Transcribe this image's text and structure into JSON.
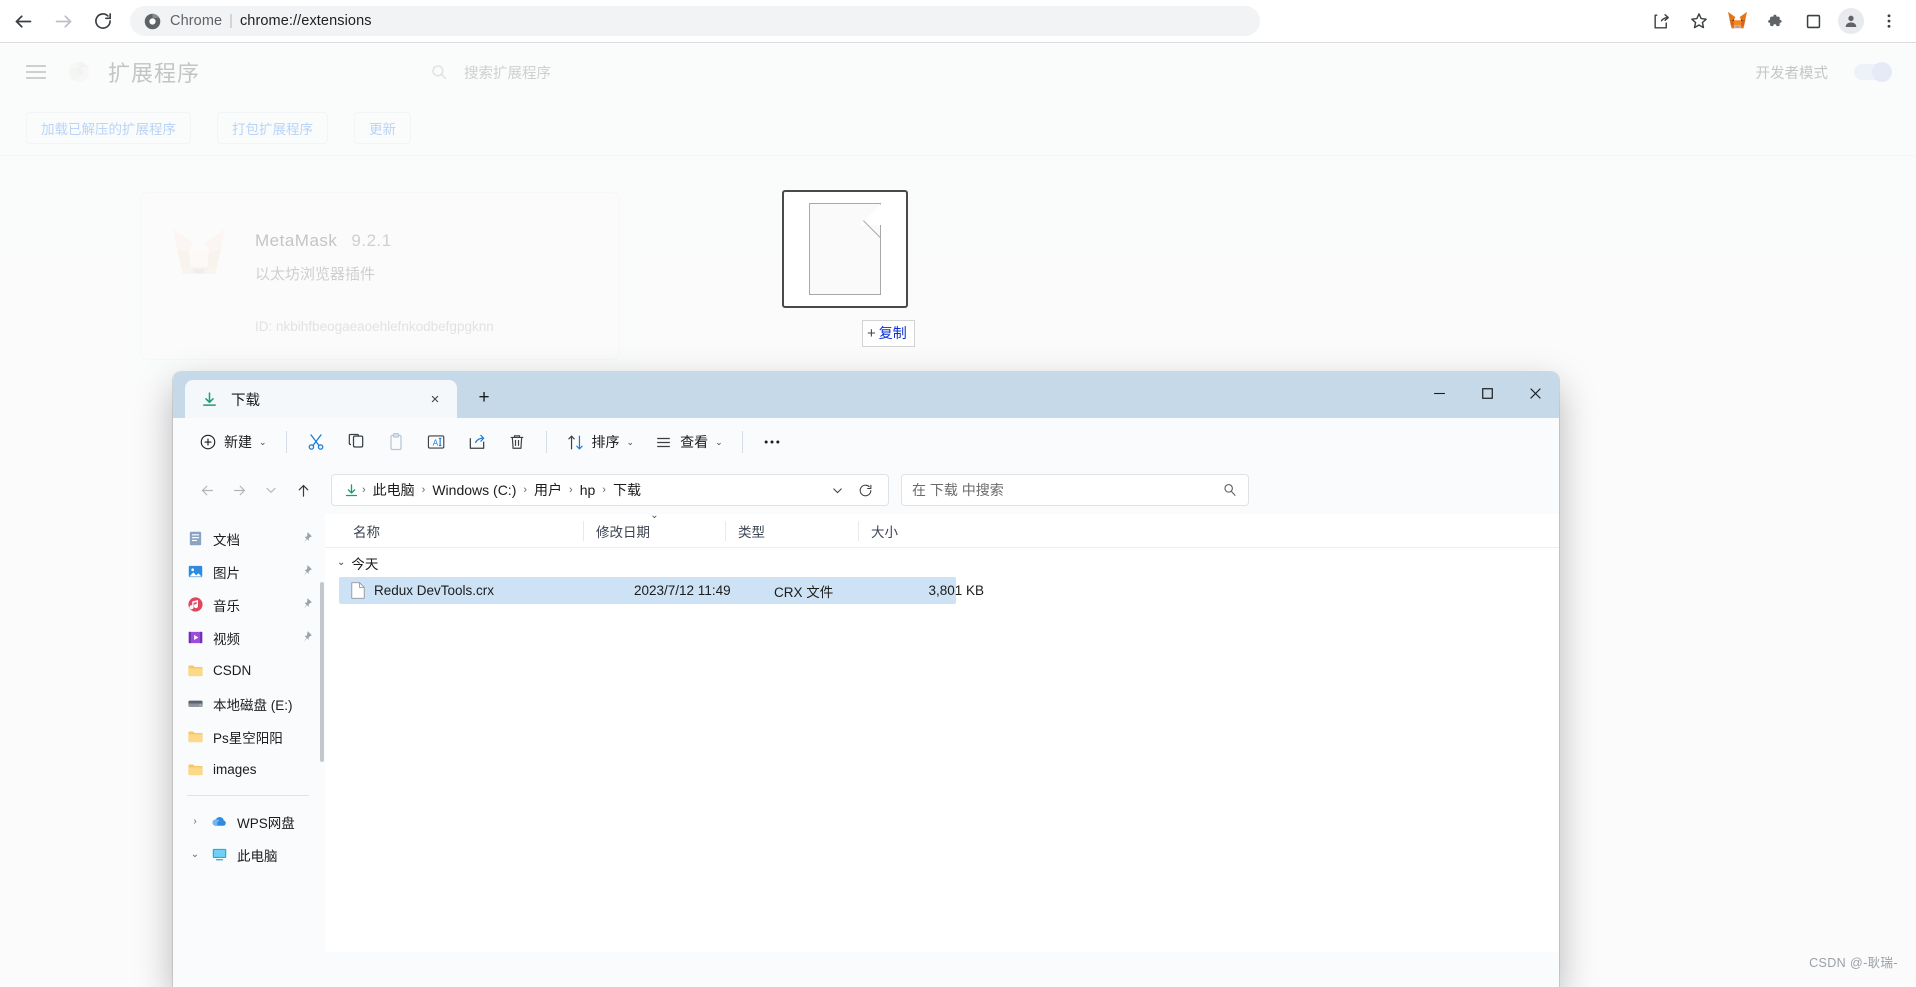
{
  "browser": {
    "nav": {
      "back": "back-arrow",
      "forward": "forward-arrow",
      "reload": "reload"
    },
    "omnibox": {
      "scheme_label": "Chrome",
      "divider": "|",
      "url": "chrome://extensions"
    },
    "right_icons": [
      "share-icon",
      "star-icon",
      "metamask-icon",
      "extensions-puzzle-icon",
      "side-panel-icon",
      "profile-avatar-icon",
      "chrome-menu-icon"
    ]
  },
  "extensions_page": {
    "title": "扩展程序",
    "search_placeholder": "搜索扩展程序",
    "devmode_label": "开发者模式",
    "devmode_on": true,
    "actions": [
      "加载已解压的扩展程序",
      "打包扩展程序",
      "更新"
    ],
    "card": {
      "name": "MetaMask",
      "version": "9.2.1",
      "description": "以太坊浏览器插件",
      "id_label": "ID:",
      "id_value": "nkbihfbeogaeaoehlefnkodbefgpgknn"
    }
  },
  "drag": {
    "badge_plus": "+",
    "badge_label": "复制"
  },
  "explorer": {
    "tab": {
      "title": "下载",
      "close": "×",
      "new_tab": "+"
    },
    "window_controls": {
      "minimize": "—",
      "maximize": "□",
      "close": "✕"
    },
    "toolbar": {
      "new_label": "新建",
      "cut_label": "剪切",
      "copy_label": "复制",
      "paste_label": "粘贴",
      "rename_label": "重命名",
      "share_label": "共享",
      "delete_label": "删除",
      "sort_label": "排序",
      "view_label": "查看",
      "more_label": "•••"
    },
    "address": {
      "crumbs": [
        "此电脑",
        "Windows (C:)",
        "用户",
        "hp",
        "下载"
      ],
      "separator": "›",
      "search_placeholder": "在 下载 中搜索"
    },
    "sidebar": [
      {
        "label": "文档",
        "icon": "documents-icon",
        "pinned": true
      },
      {
        "label": "图片",
        "icon": "pictures-icon",
        "pinned": true
      },
      {
        "label": "音乐",
        "icon": "music-icon",
        "pinned": true
      },
      {
        "label": "视频",
        "icon": "videos-icon",
        "pinned": true
      },
      {
        "label": "CSDN",
        "icon": "folder-icon",
        "pinned": false
      },
      {
        "label": "本地磁盘 (E:)",
        "icon": "drive-icon",
        "pinned": false
      },
      {
        "label": "Ps星空阳阳",
        "icon": "folder-icon",
        "pinned": false
      },
      {
        "label": "images",
        "icon": "folder-icon",
        "pinned": false
      }
    ],
    "sidebar_tree": [
      {
        "label": "WPS网盘",
        "icon": "cloud-icon",
        "expander": "›"
      },
      {
        "label": "此电脑",
        "icon": "pc-icon",
        "expander": "⌄"
      }
    ],
    "columns": [
      "名称",
      "修改日期",
      "类型",
      "大小"
    ],
    "group": {
      "caret": "⌄",
      "label": "今天"
    },
    "files": [
      {
        "name": "Redux DevTools.crx",
        "date": "2023/7/12 11:49",
        "type": "CRX 文件",
        "size": "3,801 KB",
        "selected": true
      }
    ]
  },
  "watermark": "CSDN @-耿瑞-"
}
